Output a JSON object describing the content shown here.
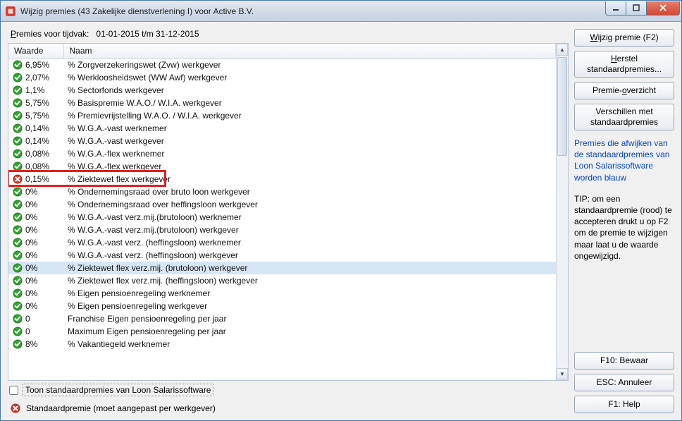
{
  "window": {
    "title": "Wijzig premies (43 Zakelijke dienstverlening I) voor Active B.V."
  },
  "period": {
    "prefix": "Premies voor tijdvak:",
    "range": "01-01-2015 t/m 31-12-2015"
  },
  "columns": {
    "waarde": "Waarde",
    "naam": "Naam"
  },
  "rows": [
    {
      "status": "ok",
      "waarde": "6,95%",
      "naam": "% Zorgverzekeringswet (Zvw) werkgever"
    },
    {
      "status": "ok",
      "waarde": "2,07%",
      "naam": "% Werkloosheidswet (WW Awf) werkgever"
    },
    {
      "status": "ok",
      "waarde": "1,1%",
      "naam": "% Sectorfonds werkgever"
    },
    {
      "status": "ok",
      "waarde": "5,75%",
      "naam": "% Basispremie W.A.O./ W.I.A. werkgever"
    },
    {
      "status": "ok",
      "waarde": "5,75%",
      "naam": "% Premievrijstelling W.A.O. / W.I.A. werkgever"
    },
    {
      "status": "ok",
      "waarde": "0,14%",
      "naam": "% W.G.A.-vast werknemer"
    },
    {
      "status": "ok",
      "waarde": "0,14%",
      "naam": "% W.G.A.-vast werkgever"
    },
    {
      "status": "ok",
      "waarde": "0,08%",
      "naam": "% W.G.A.-flex werknemer"
    },
    {
      "status": "ok",
      "waarde": "0,08%",
      "naam": "% W.G.A.-flex werkgever"
    },
    {
      "status": "err",
      "waarde": "0,15%",
      "naam": "% Ziektewet flex werkgever",
      "highlight": true
    },
    {
      "status": "ok",
      "waarde": "0%",
      "naam": "% Ondernemingsraad over bruto loon werkgever"
    },
    {
      "status": "ok",
      "waarde": "0%",
      "naam": "% Ondernemingsraad over heffingsloon werkgever"
    },
    {
      "status": "ok",
      "waarde": "0%",
      "naam": "% W.G.A.-vast verz.mij.(brutoloon) werknemer"
    },
    {
      "status": "ok",
      "waarde": "0%",
      "naam": "% W.G.A.-vast verz.mij.(brutoloon) werkgever"
    },
    {
      "status": "ok",
      "waarde": "0%",
      "naam": "% W.G.A.-vast verz. (heffingsloon) werknemer"
    },
    {
      "status": "ok",
      "waarde": "0%",
      "naam": "% W.G.A.-vast verz. (heffingsloon) werkgever"
    },
    {
      "status": "ok",
      "waarde": "0%",
      "naam": "% Ziektewet flex verz.mij. (brutoloon) werkgever",
      "selected": true
    },
    {
      "status": "ok",
      "waarde": "0%",
      "naam": "% Ziektewet flex verz.mij. (heffingsloon) werkgever"
    },
    {
      "status": "ok",
      "waarde": "0%",
      "naam": "% Eigen pensioenregeling werknemer"
    },
    {
      "status": "ok",
      "waarde": "0%",
      "naam": "% Eigen pensioenregeling werkgever"
    },
    {
      "status": "ok",
      "waarde": "0",
      "naam": "Franchise Eigen pensioenregeling per jaar"
    },
    {
      "status": "ok",
      "waarde": "0",
      "naam": "Maximum Eigen pensioenregeling per jaar"
    },
    {
      "status": "ok",
      "waarde": "8%",
      "naam": "% Vakantiegeld werknemer"
    }
  ],
  "highlight_row_index": 9,
  "checkbox": {
    "label": "Toon standaardpremies van Loon Salarissoftware"
  },
  "legend": {
    "text": "Standaardpremie (moet aangepast per werkgever)"
  },
  "buttons": {
    "wijzig": "Wijzig premie (F2)",
    "herstel_l1": "Herstel",
    "herstel_l2": "standaardpremies...",
    "overzicht": "Premie-overzicht",
    "verschillen_l1": "Verschillen met",
    "verschillen_l2": "standaardpremies",
    "bewaar": "F10: Bewaar",
    "annuleer": "ESC: Annuleer",
    "help": "F1: Help"
  },
  "notes": {
    "blue": "Premies die afwijken van de standaardpremies van Loon Salarissoftware worden blauw",
    "tip": "TIP: om een standaardpremie (rood) te accepteren drukt u op F2 om de premie te wijzigen maar laat u de waarde ongewijzigd."
  }
}
